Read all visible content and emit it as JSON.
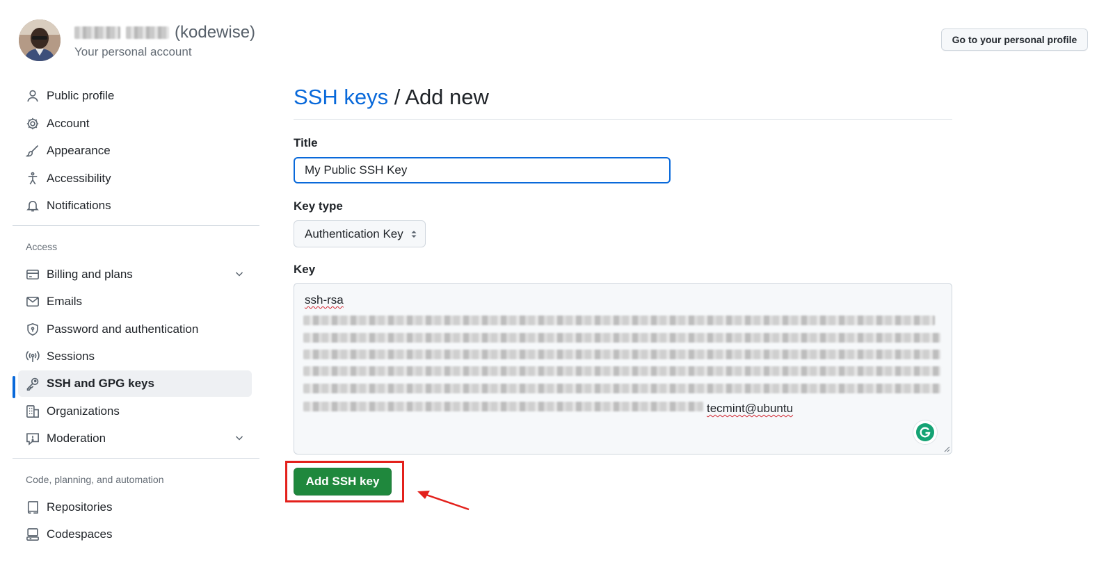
{
  "header": {
    "username_suffix": "(kodewise)",
    "account_subtitle": "Your personal account",
    "profile_button": "Go to your personal profile"
  },
  "sidebar": {
    "items_top": [
      {
        "label": "Public profile",
        "icon": "person-icon"
      },
      {
        "label": "Account",
        "icon": "gear-icon"
      },
      {
        "label": "Appearance",
        "icon": "paintbrush-icon"
      },
      {
        "label": "Accessibility",
        "icon": "accessibility-icon"
      },
      {
        "label": "Notifications",
        "icon": "bell-icon"
      }
    ],
    "access_label": "Access",
    "items_access": [
      {
        "label": "Billing and plans",
        "icon": "credit-card-icon",
        "expandable": true
      },
      {
        "label": "Emails",
        "icon": "mail-icon"
      },
      {
        "label": "Password and authentication",
        "icon": "shield-lock-icon"
      },
      {
        "label": "Sessions",
        "icon": "broadcast-icon"
      },
      {
        "label": "SSH and GPG keys",
        "icon": "key-icon",
        "active": true
      },
      {
        "label": "Organizations",
        "icon": "organization-icon"
      },
      {
        "label": "Moderation",
        "icon": "report-icon",
        "expandable": true
      }
    ],
    "code_label": "Code, planning, and automation",
    "items_code": [
      {
        "label": "Repositories",
        "icon": "repo-icon"
      },
      {
        "label": "Codespaces",
        "icon": "codespaces-icon"
      }
    ]
  },
  "main": {
    "breadcrumb_link": "SSH keys",
    "breadcrumb_separator": "/",
    "breadcrumb_current": "Add new",
    "title_label": "Title",
    "title_value": "My Public SSH Key",
    "key_type_label": "Key type",
    "key_type_value": "Authentication Key",
    "key_label": "Key",
    "key_prefix": "ssh-rsa",
    "key_suffix": "tecmint@ubuntu",
    "submit_button": "Add SSH key"
  },
  "colors": {
    "link": "#0969da",
    "primary_button": "#1f883d",
    "highlight": "#e3201b",
    "active_indicator": "#0969da"
  }
}
